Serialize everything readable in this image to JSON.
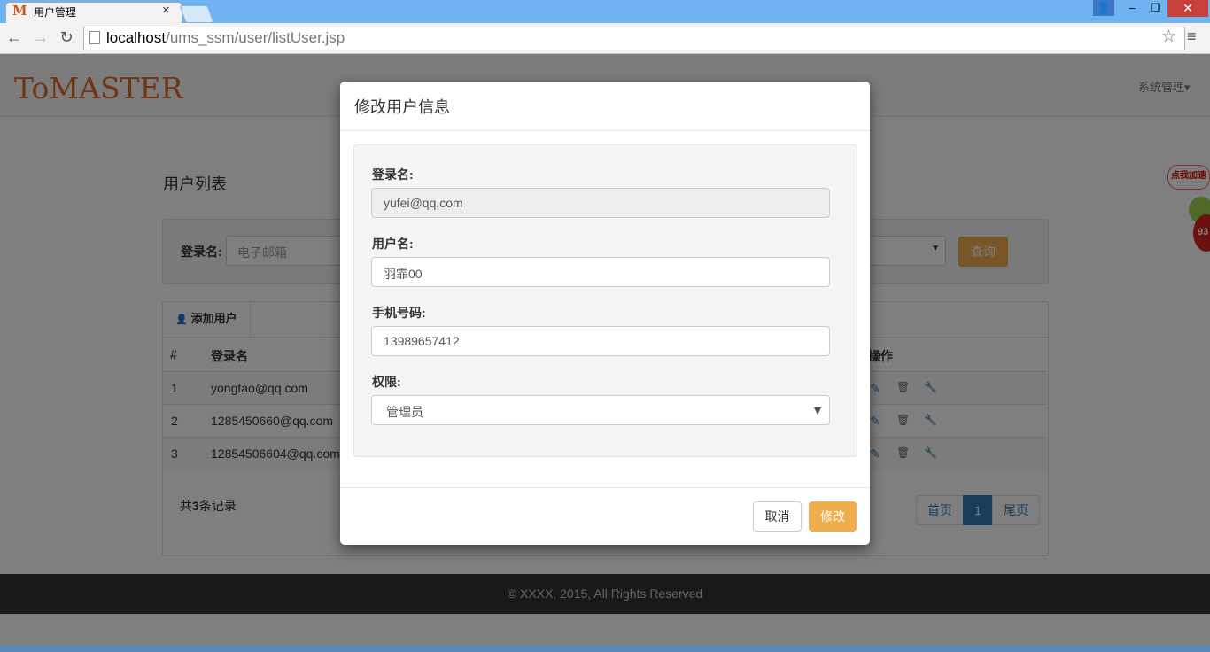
{
  "browser": {
    "tab_title": "用户管理",
    "tab_favicon": "M",
    "url_host": "localhost",
    "url_path": "/ums_ssm/user/listUser.jsp",
    "close_glyph": "×",
    "window_user": "👤",
    "window_minimize": "–",
    "window_maximize": "❐",
    "window_close": "✕",
    "back": "←",
    "forward": "→",
    "reload": "↻",
    "star": "☆",
    "menu": "≡"
  },
  "navbar": {
    "logo": "ToMASTER",
    "system_menu": "系统管理▾"
  },
  "page": {
    "title": "用户列表",
    "search": {
      "label": "登录名:",
      "placeholder": "电子邮箱",
      "select_arrow": "▼",
      "query_button": "查询"
    },
    "add_user_button": "添加用户",
    "add_user_icon": "👤",
    "table": {
      "headers": {
        "index": "#",
        "login": "登录名",
        "ops": "操作"
      },
      "rows": [
        {
          "index": "1",
          "login": "yongtao@qq.com"
        },
        {
          "index": "2",
          "login": "1285450660@qq.com"
        },
        {
          "index": "3",
          "login": "12854506604@qq.com"
        }
      ],
      "op_icons": {
        "edit": "✎",
        "delete": "🗑",
        "settings": "🔧"
      }
    },
    "count_prefix": "共",
    "count_value": "3",
    "count_suffix": "条记录",
    "pager": {
      "first": "首页",
      "current": "1",
      "last": "尾页"
    }
  },
  "footer": {
    "text": "© XXXX, 2015, All Rights Reserved"
  },
  "widget": {
    "bubble": "点我加速",
    "badge": "93"
  },
  "modal": {
    "title": "修改用户信息",
    "fields": {
      "login_label": "登录名:",
      "login_value": "yufei@qq.com",
      "username_label": "用户名:",
      "username_value": "羽霏00",
      "phone_label": "手机号码:",
      "phone_value": "13989657412",
      "role_label": "权限:",
      "role_value": "管理员",
      "role_arrow": "▼"
    },
    "cancel_button": "取消",
    "modify_button": "修改"
  }
}
